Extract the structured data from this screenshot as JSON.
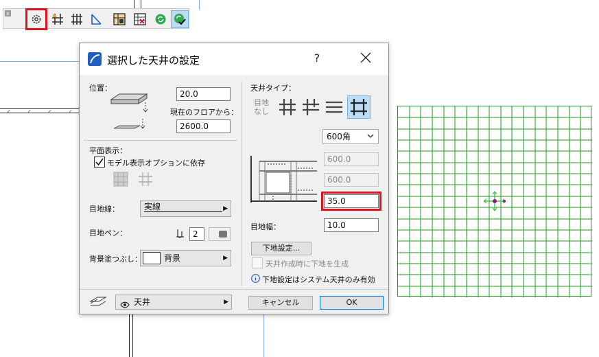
{
  "toolbar": {
    "close_label": "x",
    "buttons": [
      "settings-icon",
      "ceiling-type-icon",
      "grid-ceiling-icon",
      "slope-icon",
      "panel-icon",
      "panel-list-icon",
      "refresh-icon",
      "refresh-check-icon"
    ]
  },
  "dialog": {
    "title": "選択した天井の設定",
    "help": "?",
    "position": {
      "label": "位置：",
      "height_value": "20.0",
      "floor_label": "現在のフロアから：",
      "floor_value": "2600.0"
    },
    "plan_display": {
      "label": "平面表示：",
      "model_option_label": "モデル表示オプションに依存",
      "joint_line_label": "目地線：",
      "joint_line_value": "実線",
      "joint_pen_label": "目地ペン：",
      "joint_pen_value": "2",
      "background_fill_label": "背景塗つぶし：",
      "background_fill_value": "背景"
    },
    "ceiling_type": {
      "label": "天井タイプ：",
      "no_joint_line1": "目地",
      "no_joint_line2": "なし",
      "size_value": "600角",
      "width_value": "600.0",
      "depth_value": "600.0",
      "thickness_value": "35.0",
      "joint_width_label": "目地幅：",
      "joint_width_value": "10.0",
      "substrate_button": "下地設定...",
      "generate_substrate_label": "天井作成時に下地を生成",
      "info_text": "下地設定はシステム天井のみ有効"
    },
    "footer": {
      "layer_value": "天井",
      "cancel": "キャンセル",
      "ok": "OK"
    }
  },
  "colors": {
    "grid_green": "#1e9b1e",
    "highlight_red": "#e0141e",
    "accent_blue": "#0078d7"
  }
}
